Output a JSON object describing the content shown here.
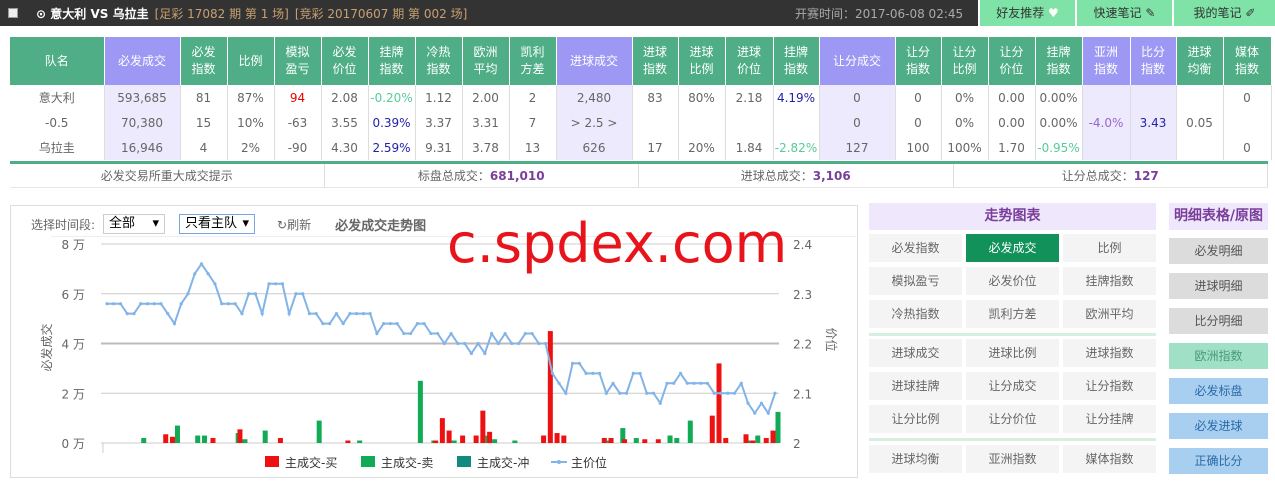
{
  "header": {
    "match_home": "意大利",
    "vs": "VS",
    "match_away": "乌拉圭",
    "zucai": "[足彩 17082 期 第 1 场]",
    "jingcai": "[竞彩 20170607 期 第 002 场]",
    "kickoff": "开赛时间：2017-06-08 02:45",
    "buttons": [
      "好友推荐",
      "快速笔记",
      "我的笔记"
    ]
  },
  "table": {
    "headers": [
      "队名",
      "必发成交",
      "必发\n指数",
      "比例",
      "模拟\n盈亏",
      "必发\n价位",
      "挂牌\n指数",
      "冷热\n指数",
      "欧洲\n平均",
      "凯利\n方差",
      "进球成交",
      "进球\n指数",
      "进球\n比例",
      "进球\n价位",
      "挂牌\n指数",
      "让分成交",
      "让分\n指数",
      "让分\n比例",
      "让分\n价位",
      "挂牌\n指数",
      "亚洲\n指数",
      "比分\n指数",
      "进球\n均衡",
      "媒体\n指数"
    ],
    "rows": [
      [
        "意大利",
        "593,685",
        "81",
        "87%",
        "94",
        "2.08",
        "-0.20%",
        "1.12",
        "2.00",
        "2",
        "2,480",
        "83",
        "80%",
        "2.18",
        "4.19%",
        "0",
        "0",
        "0%",
        "0.00",
        "0.00%",
        "",
        "",
        "",
        "0"
      ],
      [
        "-0.5",
        "70,380",
        "15",
        "10%",
        "-63",
        "3.55",
        "0.39%",
        "3.37",
        "3.31",
        "7",
        "> 2.5 >",
        "",
        "",
        "",
        "",
        "0",
        "0",
        "0%",
        "0.00",
        "0.00%",
        "-4.0%",
        "3.43",
        "0.05",
        ""
      ],
      [
        "乌拉圭",
        "16,946",
        "4",
        "2%",
        "-90",
        "4.30",
        "2.59%",
        "9.31",
        "3.78",
        "13",
        "626",
        "17",
        "20%",
        "1.84",
        "-2.82%",
        "127",
        "100",
        "100%",
        "1.70",
        "-0.95%",
        "",
        "",
        "",
        "0"
      ]
    ]
  },
  "summary": {
    "hint": "必发交易所重大成交提示",
    "total_label": "标盘总成交：",
    "total": "681,010",
    "goals_label": "进球总成交：",
    "goals": "3,106",
    "hcp_label": "让分总成交：",
    "hcp": "127"
  },
  "toolbar": {
    "period_label": "选择时间段:",
    "period_value": "全部",
    "team_value": "只看主队",
    "refresh": "刷新",
    "chart_title": "必发成交走势图"
  },
  "watermark": "c.spdex.com",
  "trend": {
    "title": "走势图表",
    "groups": [
      [
        "必发指数",
        "必发成交",
        "比例",
        "模拟盈亏",
        "必发价位",
        "挂牌指数",
        "冷热指数",
        "凯利方差",
        "欧洲平均"
      ],
      [
        "进球成交",
        "进球比例",
        "进球指数",
        "进球挂牌",
        "让分成交",
        "让分指数",
        "让分比例",
        "让分价位",
        "让分挂牌"
      ],
      [
        "进球均衡",
        "亚洲指数",
        "媒体指数"
      ]
    ],
    "active": "必发成交"
  },
  "detail": {
    "title": "明细表格/原图",
    "items": [
      "必发明细",
      "进球明细",
      "比分明细",
      "欧洲指数",
      "必发标盘",
      "必发进球",
      "正确比分"
    ]
  },
  "colors": {
    "buy": "#ee1111",
    "sell": "#11aa55",
    "flush": "#138a80",
    "price": "#82b4e8",
    "header_green": "#4fae86",
    "header_purple": "#9d98f3"
  },
  "chart_data": {
    "type": "bar+line",
    "ylabel": "必发成交",
    "y2label": "价位",
    "yticks": [
      "0 万",
      "2 万",
      "4 万",
      "6 万",
      "8 万"
    ],
    "ylim": [
      0,
      8
    ],
    "y2ticks": [
      "2",
      "2.1",
      "2.2",
      "2.3",
      "2.4"
    ],
    "y2lim": [
      2.0,
      2.4
    ],
    "legend": [
      "主成交-买",
      "主成交-卖",
      "主成交-冲",
      "主价位"
    ],
    "n": 100,
    "price": [
      2.28,
      2.28,
      2.28,
      2.26,
      2.26,
      2.28,
      2.28,
      2.28,
      2.28,
      2.26,
      2.24,
      2.28,
      2.3,
      2.34,
      2.36,
      2.34,
      2.32,
      2.28,
      2.28,
      2.28,
      2.26,
      2.3,
      2.3,
      2.26,
      2.32,
      2.32,
      2.32,
      2.26,
      2.3,
      2.3,
      2.26,
      2.26,
      2.24,
      2.24,
      2.26,
      2.24,
      2.26,
      2.26,
      2.26,
      2.26,
      2.22,
      2.24,
      2.24,
      2.24,
      2.22,
      2.22,
      2.24,
      2.24,
      2.22,
      2.22,
      2.2,
      2.22,
      2.2,
      2.2,
      2.18,
      2.2,
      2.18,
      2.22,
      2.2,
      2.22,
      2.2,
      2.2,
      2.22,
      2.22,
      2.2,
      2.2,
      2.14,
      2.12,
      2.1,
      2.16,
      2.16,
      2.14,
      2.14,
      2.14,
      2.1,
      2.12,
      2.1,
      2.1,
      2.14,
      2.14,
      2.1,
      2.1,
      2.08,
      2.12,
      2.12,
      2.14,
      2.12,
      2.12,
      2.12,
      2.12,
      2.1,
      2.1,
      2.1,
      2.1,
      2.12,
      2.08,
      2.06,
      2.08,
      2.06,
      2.1
    ],
    "sell": [
      [
        5,
        0.2
      ],
      [
        10,
        0.7
      ],
      [
        13,
        0.3
      ],
      [
        14,
        0.3
      ],
      [
        19,
        0.4
      ],
      [
        20,
        0.15
      ],
      [
        23,
        0.5
      ],
      [
        31,
        0.9
      ],
      [
        37,
        0.1
      ],
      [
        46,
        2.5
      ],
      [
        48,
        0.1
      ],
      [
        51,
        0.1
      ],
      [
        56,
        0.3
      ],
      [
        57,
        0.15
      ],
      [
        60,
        0.1
      ],
      [
        74,
        0.1
      ],
      [
        76,
        0.6
      ],
      [
        78,
        0.2
      ],
      [
        83,
        0.3
      ],
      [
        84,
        0.2
      ],
      [
        86,
        0.9
      ],
      [
        95,
        0.1
      ],
      [
        96,
        0.3
      ],
      [
        99,
        1.25
      ]
    ],
    "buy": [
      [
        9,
        0.35
      ],
      [
        10,
        0.25
      ],
      [
        16,
        0.2
      ],
      [
        20,
        0.55
      ],
      [
        26,
        0.2
      ],
      [
        36,
        0.1
      ],
      [
        49,
        0.1
      ],
      [
        50,
        1.0
      ],
      [
        51,
        0.5
      ],
      [
        53,
        0.3
      ],
      [
        55,
        0.3
      ],
      [
        56,
        1.3
      ],
      [
        57,
        0.45
      ],
      [
        65,
        0.3
      ],
      [
        66,
        4.5
      ],
      [
        67,
        0.4
      ],
      [
        68,
        0.3
      ],
      [
        74,
        0.2
      ],
      [
        75,
        0.2
      ],
      [
        77,
        0.15
      ],
      [
        80,
        0.15
      ],
      [
        82,
        0.15
      ],
      [
        90,
        1.1
      ],
      [
        91,
        3.2
      ],
      [
        92,
        0.2
      ],
      [
        95,
        0.35
      ],
      [
        96,
        0.1
      ],
      [
        98,
        0.2
      ],
      [
        99,
        0.5
      ]
    ]
  }
}
